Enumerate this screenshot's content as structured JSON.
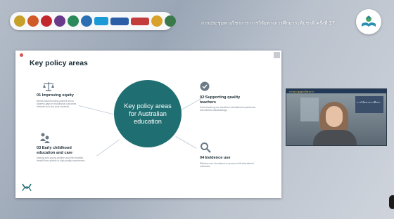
{
  "header": {
    "conference_title": "การประชุมทางวิชาการ การวิจัยทางการศึกษาระดับชาติ ครั้งที่ 17",
    "logos": [
      "partner-logo-1",
      "partner-logo-2",
      "partner-logo-3",
      "partner-logo-4",
      "partner-logo-5",
      "partner-logo-6",
      "unicef-logo",
      "partner-logo-8",
      "partner-logo-9",
      "partner-logo-10",
      "partner-logo-11"
    ],
    "colors": {
      "accent": "#1f6e72",
      "logo_colors": [
        "#c7a02a",
        "#d05a28",
        "#c2272d",
        "#6a3a8a",
        "#2a8a5a",
        "#2a6fb3",
        "#1c9ad6",
        "#2b5ea7",
        "#c43b3b",
        "#d8a12a",
        "#3a7a4a"
      ]
    }
  },
  "slide": {
    "title": "Key policy areas",
    "center_text": "Key policy areas for Australian education",
    "items": [
      {
        "icon": "scales-icon",
        "title": "01 Improving equity",
        "desc": "Needs-based funding policies aim to address gaps in educational outcomes between rich and poor students."
      },
      {
        "icon": "check-badge-icon",
        "title": "02 Supporting quality teachers",
        "desc": "Great teaching can transform educational experiences and address disadvantage."
      },
      {
        "icon": "children-icon",
        "title": "03 Early childhood education and care",
        "desc": "Making sure young children and their families benefit from access to high quality experiences."
      },
      {
        "icon": "magnifier-icon",
        "title": "04 Evidence use",
        "desc": "Effective use of evidence is proven to lift educational outcomes."
      }
    ]
  },
  "webcam": {
    "tag": "การประชุมทางวิชาการ",
    "banner": "การวิจัยทางการศึกษา"
  }
}
